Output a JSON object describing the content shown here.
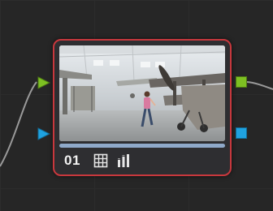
{
  "node": {
    "label": "01",
    "selected": true,
    "border_color": "#c8383d",
    "render_progress": 1.0,
    "thumbnail": "airplane-hangar-museum-person-walking"
  },
  "ports": {
    "inputs": [
      {
        "name": "rgb-input",
        "color": "#7dc022",
        "shape": "triangle"
      },
      {
        "name": "alpha-input",
        "color": "#1fa2e0",
        "shape": "triangle"
      }
    ],
    "outputs": [
      {
        "name": "rgb-output",
        "color": "#7dc022",
        "shape": "square"
      },
      {
        "name": "alpha-output",
        "color": "#1fa2e0",
        "shape": "square"
      }
    ]
  },
  "icons": {
    "grid": "grid-icon",
    "levels": "levels-icon"
  },
  "colors": {
    "background": "#262626",
    "node_body": "#2e2e31",
    "wire": "#9a9a9a"
  }
}
